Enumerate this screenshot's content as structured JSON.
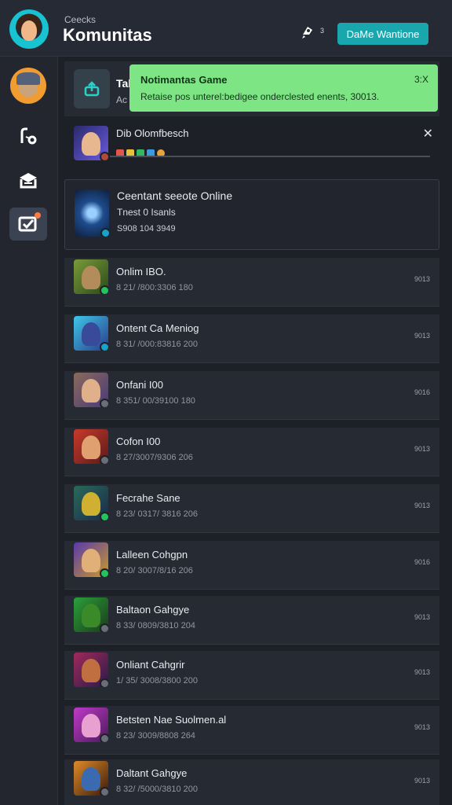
{
  "header": {
    "subtitle": "Ceecks",
    "title": "Komunitas",
    "icon_count": "3",
    "action_button": "DaMe Wantione",
    "colors": {
      "accent": "#19a7ad"
    }
  },
  "top_card": {
    "title": "Tab",
    "sub": "Ac"
  },
  "toast": {
    "title": "Notimantas Game",
    "message": "Retaise pos unterel:bedigee onderclested enents, 30013.",
    "close": "3:X",
    "color": "#7ee584"
  },
  "progress_card": {
    "title": "Dib Olomfbesch"
  },
  "featured": {
    "title": "Ceentant seeote Online",
    "line2": "Tnest 0 Isanls",
    "line3": "S908 104 3949"
  },
  "rows": [
    {
      "title": "Onlim IBO.",
      "meta": "8 21/ /800:3306 180",
      "side": "9013"
    },
    {
      "title": "Ontent Ca Meniog",
      "meta": "8 31/ /000:83816 200",
      "side": "9013"
    },
    {
      "title": "Onfani I00",
      "meta": "8 351/ 00/39100 180",
      "side": "9016"
    },
    {
      "title": "Cofon I00",
      "meta": "8 27/3007/9306 206",
      "side": "9013"
    },
    {
      "title": "Fecrahe Sane",
      "meta": "8 23/ 0317/ 3816 206",
      "side": "9013"
    },
    {
      "title": "Lalleen Cohgpn",
      "meta": "8 20/ 3007/8/16 206",
      "side": "9016"
    },
    {
      "title": "Baltaon Gahgye",
      "meta": "8 33/ 0809/3810 204",
      "side": "9013"
    },
    {
      "title": "Onliant Cahgrir",
      "meta": "1/ 35/ 3008/3800 200",
      "side": "9013"
    },
    {
      "title": "Betsten Nae Suolmen.al",
      "meta": "8 23/ 3009/8808 264",
      "side": "9013"
    },
    {
      "title": "Daltant Gahgye",
      "meta": "8 32/ /5000/3810 200",
      "side": "9013"
    }
  ],
  "icons": {
    "header": "rocket-icon",
    "sidebar": [
      "profile-avatar",
      "route-icon",
      "inbox-icon",
      "checklist-icon"
    ]
  }
}
